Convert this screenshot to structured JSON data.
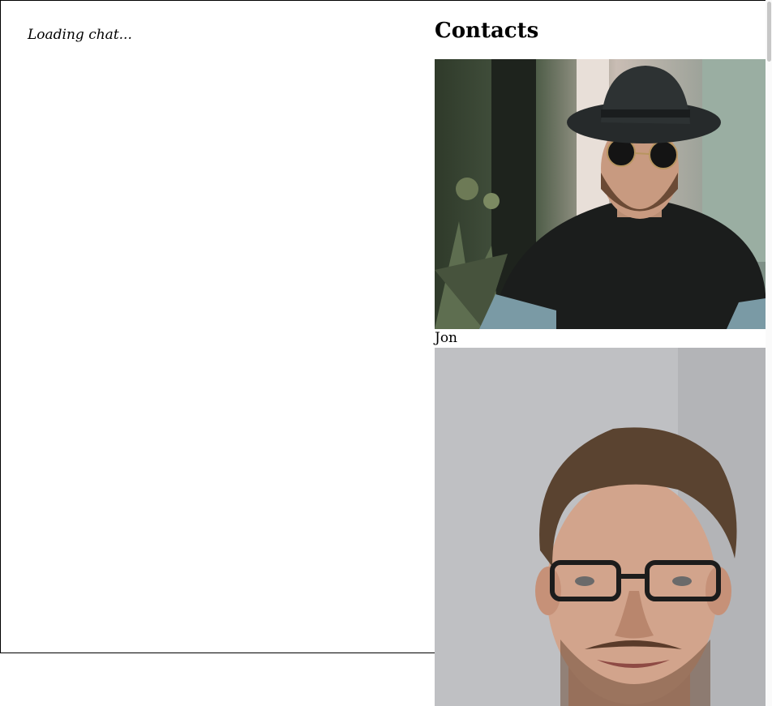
{
  "chat": {
    "status": "Loading chat..."
  },
  "contacts": {
    "heading": "Contacts",
    "items": [
      {
        "name": "Jon",
        "photo_desc": "man-with-hat-sunglasses"
      },
      {
        "name": "",
        "photo_desc": "man-with-glasses"
      }
    ]
  }
}
